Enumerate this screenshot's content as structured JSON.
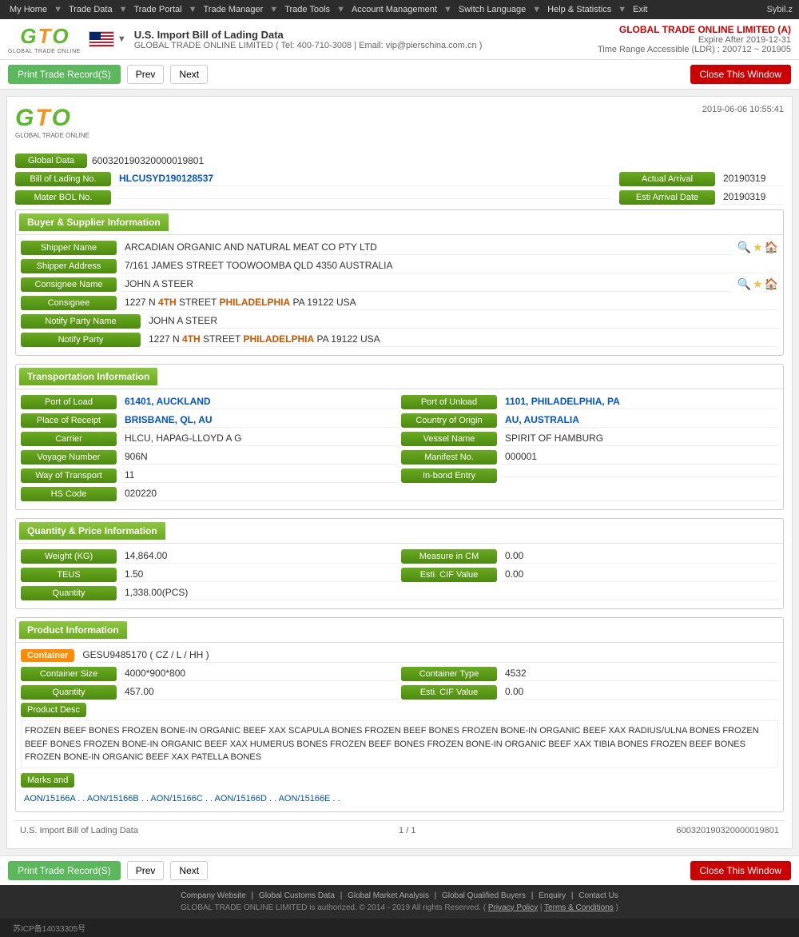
{
  "nav": {
    "items": [
      "My Home",
      "Trade Data",
      "Trade Portal",
      "Trade Manager",
      "Trade Tools",
      "Account Management",
      "Switch Language",
      "Help & Statistics",
      "Exit"
    ],
    "user": "Sybil.z"
  },
  "header": {
    "title": "U.S. Import Bill of Lading Data",
    "subtitle": "GLOBAL TRADE ONLINE LIMITED ( Tel: 400-710-3008 | Email: vip@pierschina.com.cn )",
    "company": "GLOBAL TRADE ONLINE LIMITED (A)",
    "expire": "Expire After 2019-12-31",
    "time_range": "Time Range Accessible (LDR) : 200712 ~ 201905"
  },
  "toolbar": {
    "print_label": "Print Trade Record(S)",
    "prev_label": "Prev",
    "next_label": "Next",
    "close_label": "Close This Window"
  },
  "report": {
    "datetime": "2019-06-06 10:55:41",
    "global_data_label": "Global Data",
    "global_data_value": "600320190320000019801",
    "bol_label": "Bill of Lading No.",
    "bol_value": "HLCUSYD190128537",
    "actual_arrival_label": "Actual Arrival",
    "actual_arrival_value": "20190319",
    "master_bol_label": "Mater BOL No.",
    "master_bol_value": "",
    "esti_arrival_label": "Esti Arrival Date",
    "esti_arrival_value": "20190319"
  },
  "buyer_supplier": {
    "section_title": "Buyer & Supplier Information",
    "shipper_name_label": "Shipper Name",
    "shipper_name_value": "ARCADIAN ORGANIC AND NATURAL MEAT CO PTY LTD",
    "shipper_address_label": "Shipper Address",
    "shipper_address_value": "7/161 JAMES STREET TOOWOOMBA QLD 4350 AUSTRALIA",
    "consignee_name_label": "Consignee Name",
    "consignee_name_value": "JOHN A STEER",
    "consignee_label": "Consignee",
    "consignee_value": "1227 N 4TH STREET PHILADELPHIA PA 19122 USA",
    "notify_party_name_label": "Notify Party Name",
    "notify_party_name_value": "JOHN A STEER",
    "notify_party_label": "Notify Party",
    "notify_party_value": "1227 N 4TH STREET PHILADELPHIA PA 19122 USA"
  },
  "transport": {
    "section_title": "Transportation Information",
    "port_of_load_label": "Port of Load",
    "port_of_load_value": "61401, AUCKLAND",
    "port_of_unload_label": "Port of Unload",
    "port_of_unload_value": "1101, PHILADELPHIA, PA",
    "place_of_receipt_label": "Place of Receipt",
    "place_of_receipt_value": "BRISBANE, QL, AU",
    "country_of_origin_label": "Country of Origin",
    "country_of_origin_value": "AU, AUSTRALIA",
    "carrier_label": "Carrier",
    "carrier_value": "HLCU, HAPAG-LLOYD A G",
    "vessel_name_label": "Vessel Name",
    "vessel_name_value": "SPIRIT OF HAMBURG",
    "voyage_number_label": "Voyage Number",
    "voyage_number_value": "906N",
    "manifest_no_label": "Manifest No.",
    "manifest_no_value": "000001",
    "way_of_transport_label": "Way of Transport",
    "way_of_transport_value": "11",
    "inbond_entry_label": "In-bond Entry",
    "inbond_entry_value": "",
    "hs_code_label": "HS Code",
    "hs_code_value": "020220"
  },
  "quantity": {
    "section_title": "Quantity & Price Information",
    "weight_label": "Weight (KG)",
    "weight_value": "14,864.00",
    "measure_cm_label": "Measure in CM",
    "measure_cm_value": "0.00",
    "teus_label": "TEUS",
    "teus_value": "1.50",
    "esti_cif_label": "Esti. CIF Value",
    "esti_cif_value": "0.00",
    "quantity_label": "Quantity",
    "quantity_value": "1,338.00(PCS)"
  },
  "product": {
    "section_title": "Product Information",
    "container_label": "Container",
    "container_value": "GESU9485170 ( CZ / L / HH )",
    "container_size_label": "Container Size",
    "container_size_value": "4000*900*800",
    "container_type_label": "Container Type",
    "container_type_value": "4532",
    "quantity_label": "Quantity",
    "quantity_value": "457.00",
    "esti_cif_label": "Esti. CIF Value",
    "esti_cif_value": "0.00",
    "product_desc_label": "Product Desc",
    "product_desc_text": "FROZEN BEEF BONES FROZEN BONE-IN ORGANIC BEEF XAX SCAPULA BONES FROZEN BEEF BONES FROZEN BONE-IN ORGANIC BEEF XAX RADIUS/ULNA BONES FROZEN BEEF BONES FROZEN BONE-IN ORGANIC BEEF XAX HUMERUS BONES FROZEN BEEF BONES FROZEN BONE-IN ORGANIC BEEF XAX TIBIA BONES FROZEN BEEF BONES FROZEN BONE-IN ORGANIC BEEF XAX PATELLA BONES",
    "marks_label": "Marks and",
    "marks_value": "AON/15166A . . AON/15166B . . AON/15166C . . AON/15166D . . AON/15166E . ."
  },
  "record_footer": {
    "source": "U.S. Import Bill of Lading Data",
    "page": "1 / 1",
    "id": "600320190320000019801"
  },
  "footer": {
    "links": [
      "Company Website",
      "Global Customs Data",
      "Global Market Analysis",
      "Global Qualified Buyers",
      "Enquiry",
      "Contact Us"
    ],
    "copyright": "GLOBAL TRADE ONLINE LIMITED is authorized. © 2014 - 2019 All rights Reserved.",
    "legal": [
      "Privacy Policy",
      "Terms & Conditions"
    ],
    "beian": "苏ICP备14033305号"
  }
}
